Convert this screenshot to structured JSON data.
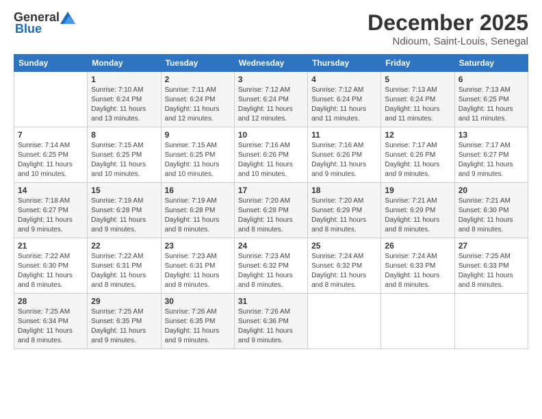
{
  "logo": {
    "general": "General",
    "blue": "Blue"
  },
  "header": {
    "title": "December 2025",
    "subtitle": "Ndioum, Saint-Louis, Senegal"
  },
  "days_of_week": [
    "Sunday",
    "Monday",
    "Tuesday",
    "Wednesday",
    "Thursday",
    "Friday",
    "Saturday"
  ],
  "weeks": [
    [
      {
        "day": "",
        "sunrise": "",
        "sunset": "",
        "daylight": ""
      },
      {
        "day": "1",
        "sunrise": "Sunrise: 7:10 AM",
        "sunset": "Sunset: 6:24 PM",
        "daylight": "Daylight: 11 hours and 13 minutes."
      },
      {
        "day": "2",
        "sunrise": "Sunrise: 7:11 AM",
        "sunset": "Sunset: 6:24 PM",
        "daylight": "Daylight: 11 hours and 12 minutes."
      },
      {
        "day": "3",
        "sunrise": "Sunrise: 7:12 AM",
        "sunset": "Sunset: 6:24 PM",
        "daylight": "Daylight: 11 hours and 12 minutes."
      },
      {
        "day": "4",
        "sunrise": "Sunrise: 7:12 AM",
        "sunset": "Sunset: 6:24 PM",
        "daylight": "Daylight: 11 hours and 11 minutes."
      },
      {
        "day": "5",
        "sunrise": "Sunrise: 7:13 AM",
        "sunset": "Sunset: 6:24 PM",
        "daylight": "Daylight: 11 hours and 11 minutes."
      },
      {
        "day": "6",
        "sunrise": "Sunrise: 7:13 AM",
        "sunset": "Sunset: 6:25 PM",
        "daylight": "Daylight: 11 hours and 11 minutes."
      }
    ],
    [
      {
        "day": "7",
        "sunrise": "Sunrise: 7:14 AM",
        "sunset": "Sunset: 6:25 PM",
        "daylight": "Daylight: 11 hours and 10 minutes."
      },
      {
        "day": "8",
        "sunrise": "Sunrise: 7:15 AM",
        "sunset": "Sunset: 6:25 PM",
        "daylight": "Daylight: 11 hours and 10 minutes."
      },
      {
        "day": "9",
        "sunrise": "Sunrise: 7:15 AM",
        "sunset": "Sunset: 6:25 PM",
        "daylight": "Daylight: 11 hours and 10 minutes."
      },
      {
        "day": "10",
        "sunrise": "Sunrise: 7:16 AM",
        "sunset": "Sunset: 6:26 PM",
        "daylight": "Daylight: 11 hours and 10 minutes."
      },
      {
        "day": "11",
        "sunrise": "Sunrise: 7:16 AM",
        "sunset": "Sunset: 6:26 PM",
        "daylight": "Daylight: 11 hours and 9 minutes."
      },
      {
        "day": "12",
        "sunrise": "Sunrise: 7:17 AM",
        "sunset": "Sunset: 6:26 PM",
        "daylight": "Daylight: 11 hours and 9 minutes."
      },
      {
        "day": "13",
        "sunrise": "Sunrise: 7:17 AM",
        "sunset": "Sunset: 6:27 PM",
        "daylight": "Daylight: 11 hours and 9 minutes."
      }
    ],
    [
      {
        "day": "14",
        "sunrise": "Sunrise: 7:18 AM",
        "sunset": "Sunset: 6:27 PM",
        "daylight": "Daylight: 11 hours and 9 minutes."
      },
      {
        "day": "15",
        "sunrise": "Sunrise: 7:19 AM",
        "sunset": "Sunset: 6:28 PM",
        "daylight": "Daylight: 11 hours and 9 minutes."
      },
      {
        "day": "16",
        "sunrise": "Sunrise: 7:19 AM",
        "sunset": "Sunset: 6:28 PM",
        "daylight": "Daylight: 11 hours and 8 minutes."
      },
      {
        "day": "17",
        "sunrise": "Sunrise: 7:20 AM",
        "sunset": "Sunset: 6:28 PM",
        "daylight": "Daylight: 11 hours and 8 minutes."
      },
      {
        "day": "18",
        "sunrise": "Sunrise: 7:20 AM",
        "sunset": "Sunset: 6:29 PM",
        "daylight": "Daylight: 11 hours and 8 minutes."
      },
      {
        "day": "19",
        "sunrise": "Sunrise: 7:21 AM",
        "sunset": "Sunset: 6:29 PM",
        "daylight": "Daylight: 11 hours and 8 minutes."
      },
      {
        "day": "20",
        "sunrise": "Sunrise: 7:21 AM",
        "sunset": "Sunset: 6:30 PM",
        "daylight": "Daylight: 11 hours and 8 minutes."
      }
    ],
    [
      {
        "day": "21",
        "sunrise": "Sunrise: 7:22 AM",
        "sunset": "Sunset: 6:30 PM",
        "daylight": "Daylight: 11 hours and 8 minutes."
      },
      {
        "day": "22",
        "sunrise": "Sunrise: 7:22 AM",
        "sunset": "Sunset: 6:31 PM",
        "daylight": "Daylight: 11 hours and 8 minutes."
      },
      {
        "day": "23",
        "sunrise": "Sunrise: 7:23 AM",
        "sunset": "Sunset: 6:31 PM",
        "daylight": "Daylight: 11 hours and 8 minutes."
      },
      {
        "day": "24",
        "sunrise": "Sunrise: 7:23 AM",
        "sunset": "Sunset: 6:32 PM",
        "daylight": "Daylight: 11 hours and 8 minutes."
      },
      {
        "day": "25",
        "sunrise": "Sunrise: 7:24 AM",
        "sunset": "Sunset: 6:32 PM",
        "daylight": "Daylight: 11 hours and 8 minutes."
      },
      {
        "day": "26",
        "sunrise": "Sunrise: 7:24 AM",
        "sunset": "Sunset: 6:33 PM",
        "daylight": "Daylight: 11 hours and 8 minutes."
      },
      {
        "day": "27",
        "sunrise": "Sunrise: 7:25 AM",
        "sunset": "Sunset: 6:33 PM",
        "daylight": "Daylight: 11 hours and 8 minutes."
      }
    ],
    [
      {
        "day": "28",
        "sunrise": "Sunrise: 7:25 AM",
        "sunset": "Sunset: 6:34 PM",
        "daylight": "Daylight: 11 hours and 8 minutes."
      },
      {
        "day": "29",
        "sunrise": "Sunrise: 7:25 AM",
        "sunset": "Sunset: 6:35 PM",
        "daylight": "Daylight: 11 hours and 9 minutes."
      },
      {
        "day": "30",
        "sunrise": "Sunrise: 7:26 AM",
        "sunset": "Sunset: 6:35 PM",
        "daylight": "Daylight: 11 hours and 9 minutes."
      },
      {
        "day": "31",
        "sunrise": "Sunrise: 7:26 AM",
        "sunset": "Sunset: 6:36 PM",
        "daylight": "Daylight: 11 hours and 9 minutes."
      },
      {
        "day": "",
        "sunrise": "",
        "sunset": "",
        "daylight": ""
      },
      {
        "day": "",
        "sunrise": "",
        "sunset": "",
        "daylight": ""
      },
      {
        "day": "",
        "sunrise": "",
        "sunset": "",
        "daylight": ""
      }
    ]
  ]
}
